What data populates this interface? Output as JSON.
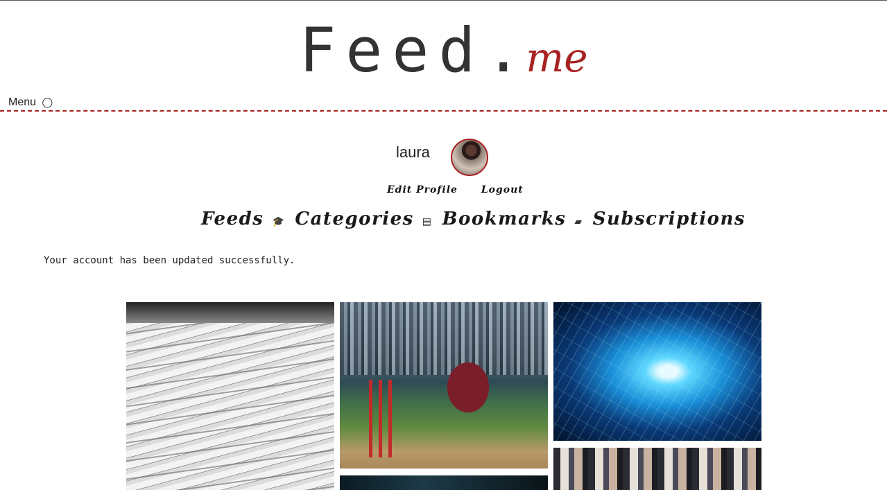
{
  "logo": {
    "main": "Feed",
    "dot": ".",
    "sub": "me"
  },
  "menu": {
    "label": "Menu",
    "icon": "refresh-icon"
  },
  "user": {
    "name": "laura",
    "edit_profile": "Edit Profile",
    "logout": "Logout"
  },
  "nav": [
    {
      "label": "Feeds",
      "icon": "graduation-cap-icon",
      "icon_glyph": "🎓"
    },
    {
      "label": "Categories",
      "icon": "newspaper-icon",
      "icon_glyph": "▤"
    },
    {
      "label": "Bookmarks",
      "icon": "book-icon",
      "icon_glyph": "▰"
    },
    {
      "label": "Subscriptions"
    }
  ],
  "message": "Your account has been updated successfully.",
  "colors": {
    "accent": "#a82222",
    "text": "#2a2a2a"
  },
  "tiles": [
    "newspapers-image",
    "cricket-image",
    "circuit-image",
    "fashion-image",
    "dark-image"
  ]
}
